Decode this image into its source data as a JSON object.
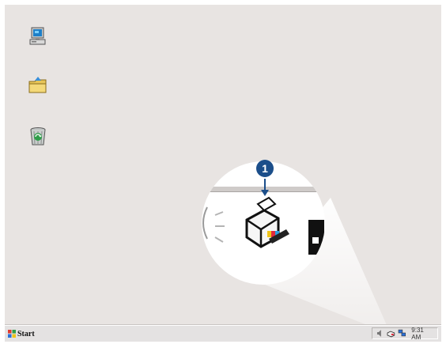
{
  "desktop": {
    "icons": [
      {
        "name": "my-computer-icon"
      },
      {
        "name": "folder-icon"
      },
      {
        "name": "recycle-bin-icon"
      }
    ]
  },
  "callout": {
    "number": "1",
    "subject": "printer-icon"
  },
  "taskbar": {
    "start_label": "Start",
    "tray_icons": [
      "speaker-icon",
      "printer-status-icon",
      "network-icon"
    ],
    "clock": "9:31 AM"
  }
}
